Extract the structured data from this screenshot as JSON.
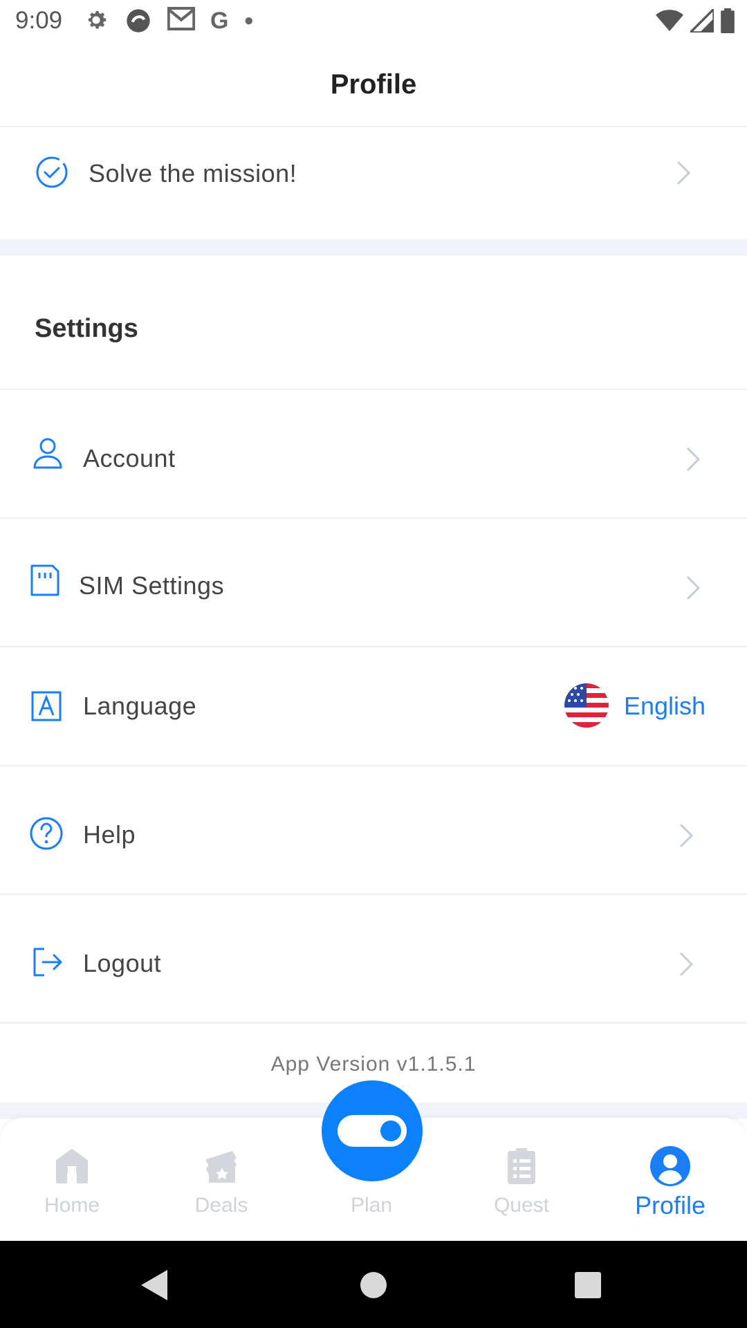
{
  "status_bar": {
    "time": "9:09",
    "icons": [
      "gear-icon",
      "data-saver-icon",
      "gmail-icon",
      "google-icon",
      "dot-icon"
    ],
    "right_icons": [
      "wifi-icon",
      "signal-icon",
      "battery-icon"
    ]
  },
  "header": {
    "title": "Profile"
  },
  "mission": {
    "label": "Solve the mission!"
  },
  "settings": {
    "title": "Settings",
    "items": [
      {
        "label": "Account",
        "icon": "user-icon"
      },
      {
        "label": "SIM Settings",
        "icon": "sim-card-icon"
      },
      {
        "label": "Language",
        "icon": "language-icon",
        "value": "English",
        "flag": "us-flag-icon"
      },
      {
        "label": "Help",
        "icon": "help-icon"
      },
      {
        "label": "Logout",
        "icon": "logout-icon"
      }
    ]
  },
  "app_version": "App Version v1.1.5.1",
  "bottom_nav": {
    "items": [
      {
        "label": "Home",
        "icon": "home-icon"
      },
      {
        "label": "Deals",
        "icon": "ticket-icon"
      },
      {
        "label": "Plan",
        "icon": "toggle-icon"
      },
      {
        "label": "Quest",
        "icon": "checklist-icon"
      },
      {
        "label": "Profile",
        "icon": "profile-icon",
        "active": true
      }
    ]
  },
  "colors": {
    "accent": "#1a7ef6",
    "plan_button": "#0b82fb",
    "band": "#f1f5fa",
    "inactive": "#cfd3d8"
  }
}
